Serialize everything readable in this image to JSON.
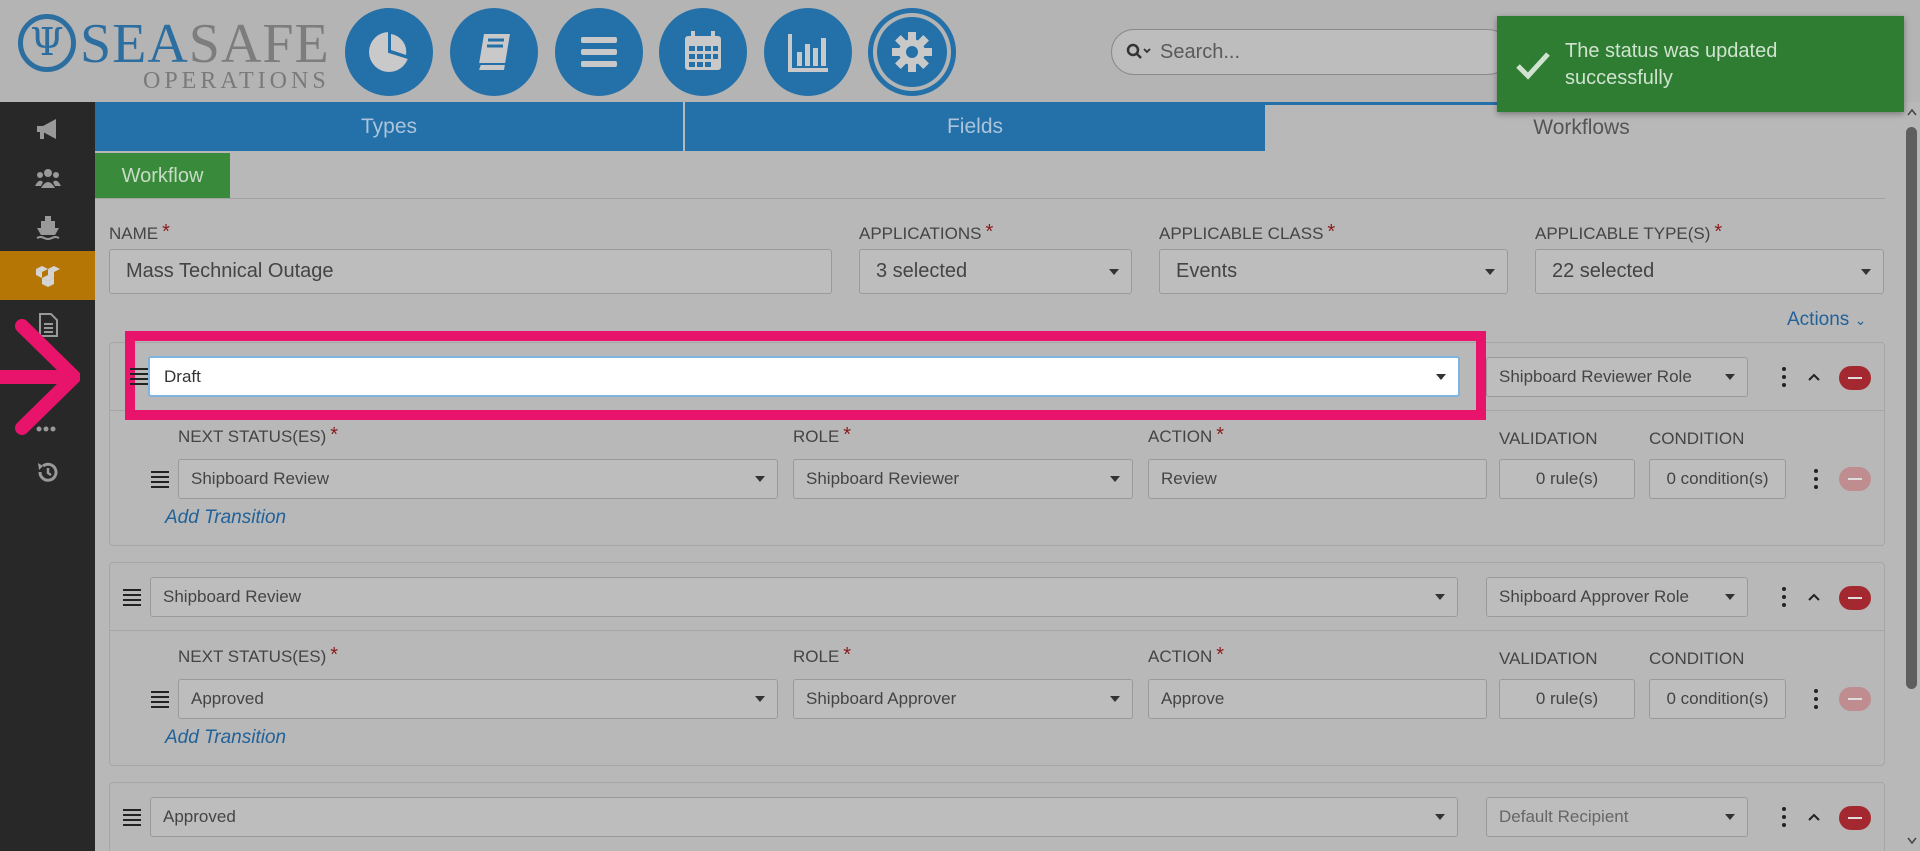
{
  "logo": {
    "brand_part1": "SEA",
    "brand_part2": "SAFE",
    "subtitle": "OPERATIONS"
  },
  "nav_icons": [
    "dashboard-icon",
    "logbook-icon",
    "list-icon",
    "calendar-icon",
    "reports-icon",
    "settings-icon"
  ],
  "search": {
    "placeholder": "Search..."
  },
  "toast": {
    "message": "The status was updated successfully"
  },
  "sidebar": {
    "items": [
      "megaphone-icon",
      "users-icon",
      "ship-icon",
      "workflow-icon",
      "document-icon",
      "more-icon",
      "history-icon"
    ],
    "active_index": 3
  },
  "tabs": [
    {
      "label": "Types"
    },
    {
      "label": "Fields"
    },
    {
      "label": "Workflows"
    }
  ],
  "workflow_tab": "Workflow",
  "form": {
    "name": {
      "label": "NAME",
      "value": "Mass Technical Outage"
    },
    "applications": {
      "label": "APPLICATIONS",
      "value": "3 selected"
    },
    "applicable_class": {
      "label": "APPLICABLE CLASS",
      "value": "Events"
    },
    "applicable_types": {
      "label": "APPLICABLE TYPE(S)",
      "value": "22 selected"
    }
  },
  "actions_label": "Actions",
  "columns": {
    "next_status": "NEXT STATUS(ES)",
    "role": "ROLE",
    "action": "ACTION",
    "validation": "VALIDATION",
    "condition": "CONDITION"
  },
  "add_transition": "Add Transition",
  "statuses": [
    {
      "status": "Draft",
      "role_group": "Shipboard Reviewer Role",
      "transition": {
        "next": "Shipboard Review",
        "role": "Shipboard Reviewer",
        "action": "Review",
        "validation": "0 rule(s)",
        "condition": "0 condition(s)"
      }
    },
    {
      "status": "Shipboard Review",
      "role_group": "Shipboard Approver Role",
      "transition": {
        "next": "Approved",
        "role": "Shipboard Approver",
        "action": "Approve",
        "validation": "0 rule(s)",
        "condition": "0 condition(s)"
      }
    },
    {
      "status": "Approved",
      "role_group": "Default Recipient"
    }
  ],
  "colors": {
    "primary": "#2470a8",
    "active_sidebar": "#b57606",
    "toast": "#2f7d33",
    "highlight": "#e8146b",
    "danger": "#a3282f"
  }
}
